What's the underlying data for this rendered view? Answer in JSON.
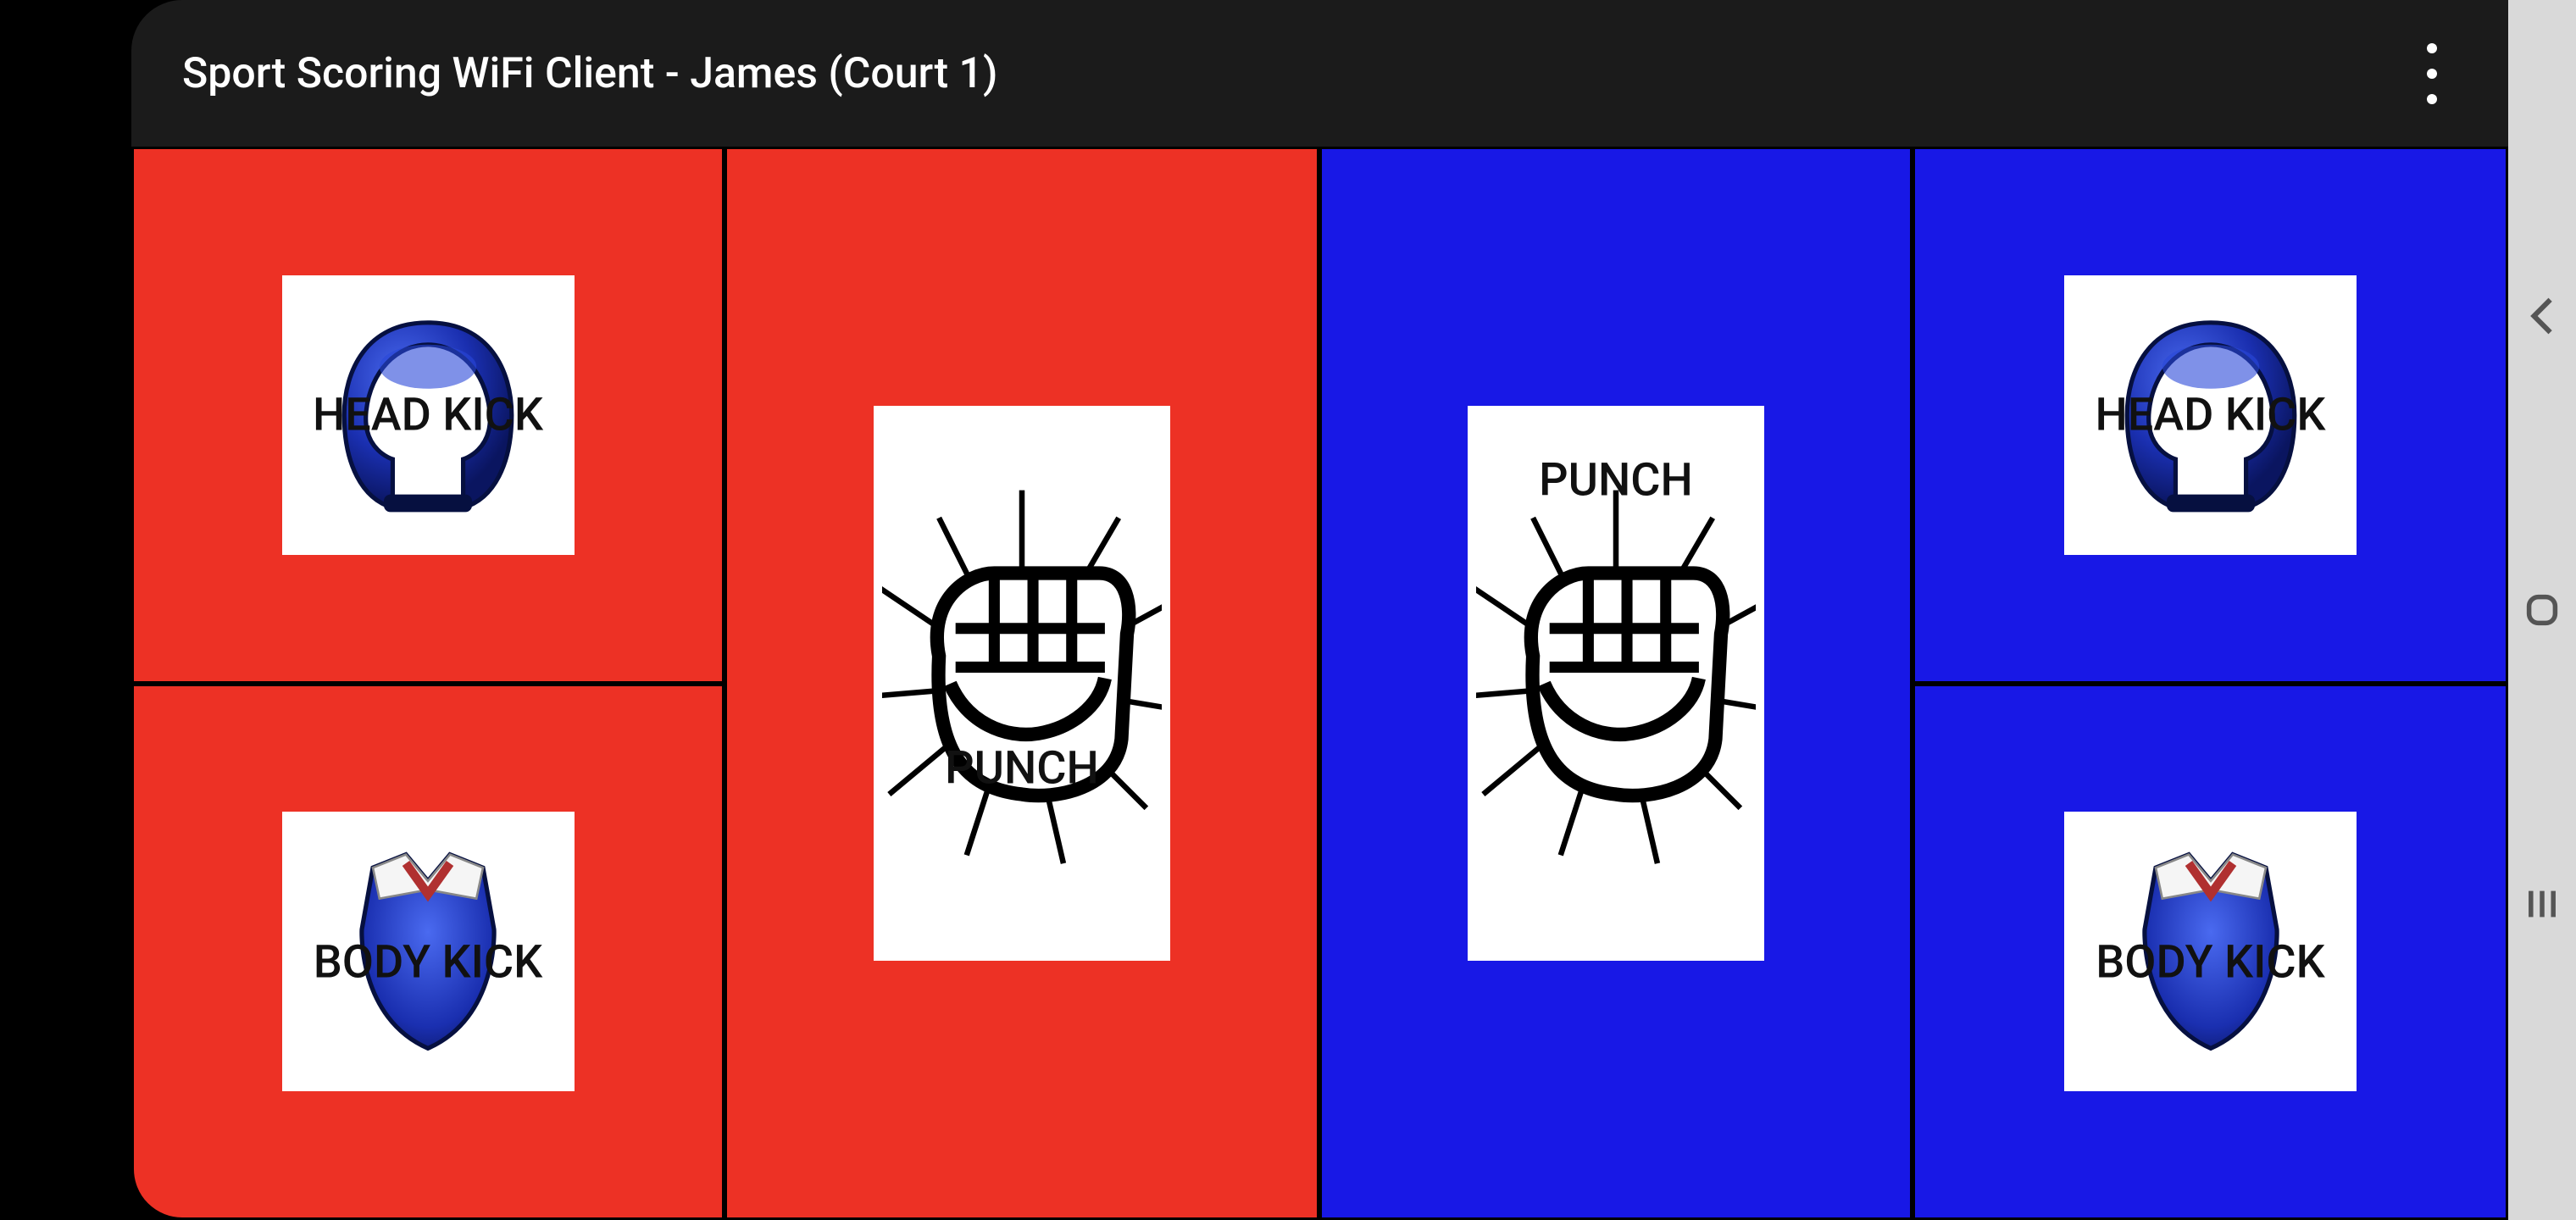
{
  "header": {
    "title": "Sport Scoring WiFi Client  -  James  (Court 1)"
  },
  "icons": {
    "more": "more-vert-icon",
    "back": "back-icon",
    "home": "home-icon",
    "recent": "recent-apps-icon",
    "helmet": "helmet-icon",
    "chest": "chest-guard-icon",
    "punch": "fist-icon"
  },
  "colors": {
    "red": "#ed3125",
    "blue": "#1818e6",
    "topbar": "#1b1b1b"
  },
  "buttons": {
    "red_head_kick": {
      "label": "HEAD KICK"
    },
    "red_body_kick": {
      "label": "BODY KICK"
    },
    "red_punch": {
      "label": "PUNCH"
    },
    "blue_punch": {
      "label": "PUNCH"
    },
    "blue_head_kick": {
      "label": "HEAD KICK"
    },
    "blue_body_kick": {
      "label": "BODY KICK"
    }
  }
}
